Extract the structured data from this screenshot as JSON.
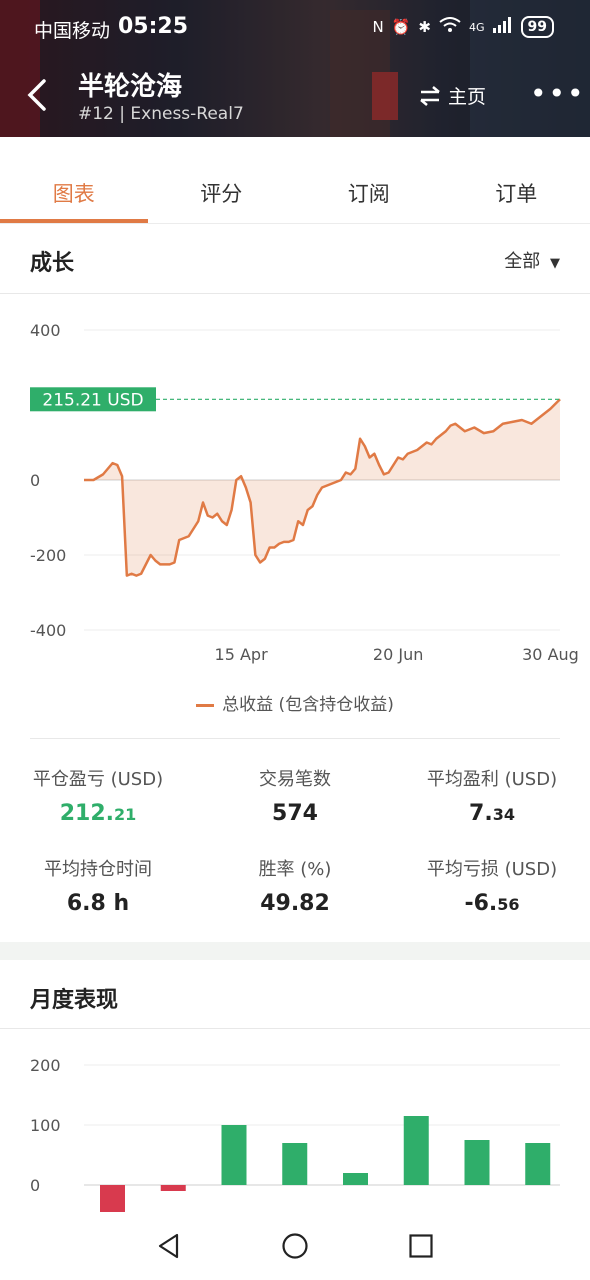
{
  "status_bar": {
    "carrier": "中国移动",
    "time": "05:25",
    "network": "4G",
    "battery": "99"
  },
  "header": {
    "title": "半轮沧海",
    "subtitle": "#12 | Exness-Real7",
    "home_label": "主页"
  },
  "tabs": [
    {
      "label": "图表",
      "active": true
    },
    {
      "label": "评分",
      "active": false
    },
    {
      "label": "订阅",
      "active": false
    },
    {
      "label": "订单",
      "active": false
    }
  ],
  "growth": {
    "title": "成长",
    "filter": "全部",
    "current_value_label": "215.21 USD",
    "legend": "总收益 (包含持仓收益)"
  },
  "stats": [
    {
      "label": "平仓盈亏 (USD)",
      "value_main": "212.",
      "value_small": "21",
      "color": "#2fae6a"
    },
    {
      "label": "交易笔数",
      "value_main": "574",
      "value_small": ""
    },
    {
      "label": "平均盈利 (USD)",
      "value_main": "7.",
      "value_small": "34"
    },
    {
      "label": "平均持仓时间",
      "value_main": "6.8 h",
      "value_small": ""
    },
    {
      "label": "胜率 (%)",
      "value_main": "49.82",
      "value_small": ""
    },
    {
      "label": "平均亏损 (USD)",
      "value_main": "-6.",
      "value_small": "56"
    }
  ],
  "monthly": {
    "title": "月度表现"
  },
  "colors": {
    "accent": "#e07a45",
    "profit": "#2fae6a",
    "loss": "#d83a4e"
  },
  "chart_data": [
    {
      "type": "area",
      "xlabel": "",
      "ylabel": "",
      "ylim": [
        -400,
        400
      ],
      "yticks": [
        "400",
        "0",
        "-200",
        "-400"
      ],
      "ytick_values": [
        400,
        0,
        -200,
        -400
      ],
      "xticks": [
        "15 Apr",
        "20 Jun",
        "30 Aug"
      ],
      "xtick_positions": [
        0.33,
        0.66,
        0.98
      ],
      "grid": true,
      "series": [
        {
          "name": "总收益 (包含持仓收益)",
          "x": [
            0,
            0.02,
            0.04,
            0.05,
            0.06,
            0.07,
            0.08,
            0.09,
            0.1,
            0.11,
            0.12,
            0.14,
            0.15,
            0.16,
            0.18,
            0.19,
            0.2,
            0.22,
            0.24,
            0.25,
            0.26,
            0.27,
            0.28,
            0.29,
            0.3,
            0.31,
            0.32,
            0.33,
            0.34,
            0.35,
            0.36,
            0.37,
            0.38,
            0.39,
            0.4,
            0.41,
            0.42,
            0.43,
            0.44,
            0.45,
            0.46,
            0.47,
            0.48,
            0.49,
            0.5,
            0.52,
            0.54,
            0.55,
            0.56,
            0.57,
            0.58,
            0.59,
            0.6,
            0.61,
            0.62,
            0.63,
            0.64,
            0.65,
            0.66,
            0.67,
            0.68,
            0.69,
            0.7,
            0.71,
            0.72,
            0.73,
            0.74,
            0.75,
            0.76,
            0.77,
            0.78,
            0.79,
            0.8,
            0.82,
            0.84,
            0.86,
            0.88,
            0.9,
            0.92,
            0.94,
            0.96,
            0.98,
            1.0
          ],
          "values": [
            0,
            0,
            15,
            30,
            45,
            40,
            10,
            -255,
            -250,
            -255,
            -250,
            -200,
            -215,
            -225,
            -225,
            -220,
            -160,
            -150,
            -110,
            -60,
            -95,
            -100,
            -90,
            -110,
            -120,
            -80,
            0,
            10,
            -20,
            -60,
            -200,
            -220,
            -210,
            -180,
            -180,
            -170,
            -165,
            -165,
            -160,
            -110,
            -120,
            -80,
            -70,
            -40,
            -20,
            -10,
            0,
            20,
            15,
            30,
            110,
            90,
            60,
            70,
            40,
            15,
            20,
            40,
            60,
            55,
            70,
            75,
            80,
            90,
            100,
            95,
            110,
            120,
            130,
            145,
            150,
            140,
            130,
            140,
            125,
            130,
            150,
            155,
            160,
            150,
            170,
            190,
            215.21
          ]
        }
      ]
    },
    {
      "type": "bar",
      "ylim": [
        -50,
        200
      ],
      "yticks": [
        "200",
        "100",
        "0"
      ],
      "ytick_values": [
        200,
        100,
        0
      ],
      "grid": true,
      "categories": [
        "",
        "",
        "",
        "",
        "",
        "",
        "",
        ""
      ],
      "values": [
        -52,
        -10,
        100,
        70,
        20,
        115,
        75,
        70
      ]
    }
  ]
}
